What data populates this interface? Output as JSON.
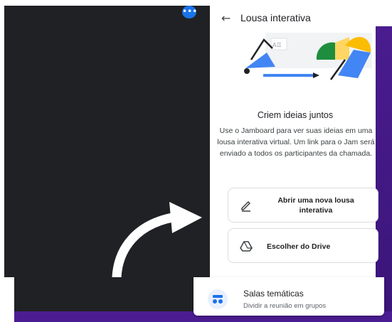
{
  "meeting": {
    "more_options_label": "•••"
  },
  "panel": {
    "title": "Lousa interativa",
    "back_icon": "arrow-left-icon",
    "heading": "Criem ideias juntos",
    "description": "Use o Jamboard para ver suas ideias em uma lousa interativa virtual. Um link para o Jam será enviado a todos os participantes da chamada.",
    "options": [
      {
        "label": "Abrir uma nova lousa interativa",
        "icon": "pen-icon"
      },
      {
        "label": "Escolher do Drive",
        "icon": "google-drive-icon"
      }
    ]
  },
  "breakout": {
    "title": "Salas temáticas",
    "subtitle": "Dividir a reunião em grupos",
    "icon": "breakout-rooms-icon"
  },
  "colors": {
    "meeting_bg": "#202124",
    "accent_blue": "#1a73e8",
    "purple_bg": "#4b1d92"
  }
}
